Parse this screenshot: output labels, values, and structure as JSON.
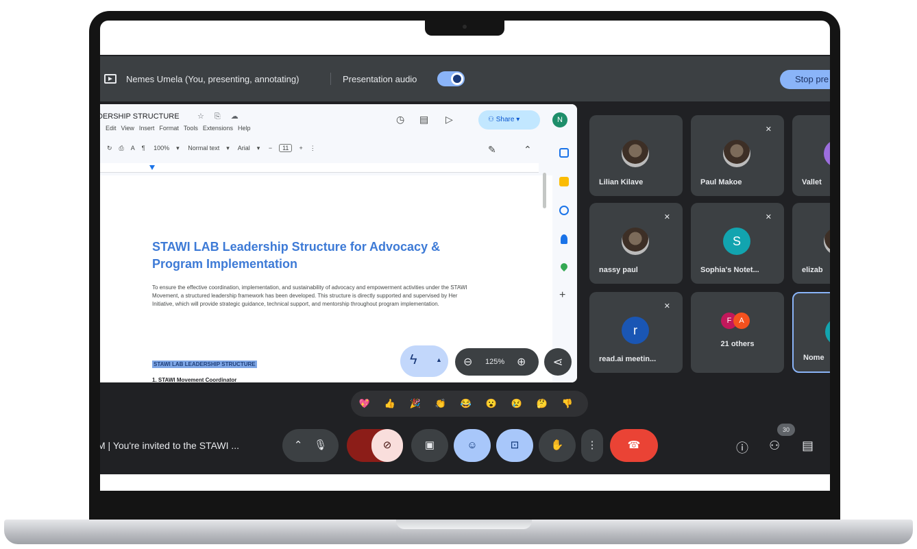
{
  "presenting_bar": {
    "presenter": "Nemes Umela (You, presenting, annotating)",
    "audio_label": "Presentation audio",
    "stop_label": "Stop pre"
  },
  "doc": {
    "title": "DERSHIP STRUCTURE",
    "menu": [
      "Edit",
      "View",
      "Insert",
      "Format",
      "Tools",
      "Extensions",
      "Help"
    ],
    "zoom": "100%",
    "style": "Normal text",
    "font": "Arial",
    "font_size": "11",
    "share_label": "Share",
    "avatar_letter": "N",
    "heading": "STAWI LAB Leadership Structure for Advocacy & Program Implementation",
    "body": "To ensure the effective coordination, implementation, and sustainability of advocacy and empowerment activities under the STAWI Movement, a structured leadership framework has been developed. This structure is directly supported and supervised by Her Initiative, which will provide strategic guidance, technical support, and mentorship throughout program implementation.",
    "subheading": "STAWI LAB LEADERSHIP STRUCTURE",
    "cut_line": "1.  STAWI Movement Coordinator",
    "zoom_level": "125%"
  },
  "participants": [
    {
      "name": "Lilian Kilave",
      "muted": false,
      "avatar": "photo"
    },
    {
      "name": "Paul Makoe",
      "muted": true,
      "avatar": "photo"
    },
    {
      "name": "Vallet",
      "muted": false,
      "avatar": "purple"
    },
    {
      "name": "nassy paul",
      "muted": true,
      "avatar": "photo"
    },
    {
      "name": "Sophia's Notet...",
      "muted": true,
      "avatar": "S"
    },
    {
      "name": "elizab",
      "muted": false,
      "avatar": "photo"
    },
    {
      "name": "read.ai meetin...",
      "muted": true,
      "avatar": "r"
    },
    {
      "name": "21 others",
      "muted": false,
      "avatar_letters": [
        "F",
        "A"
      ]
    },
    {
      "name": "Nome",
      "muted": false,
      "avatar": "teal"
    }
  ],
  "reactions": [
    "💖",
    "👍",
    "🎉",
    "👏",
    "😂",
    "😮",
    "😢",
    "🤔",
    "👎"
  ],
  "bottom_bar": {
    "meeting_title": "M  |  You're invited to the STAWI ...",
    "people_count": "30"
  },
  "colors": {
    "meet_bg": "#202124",
    "tile_bg": "#3c4043",
    "accent_blue": "#8ab4f8",
    "end_call_red": "#ea4335",
    "doc_heading_blue": "#3d7ad6"
  }
}
